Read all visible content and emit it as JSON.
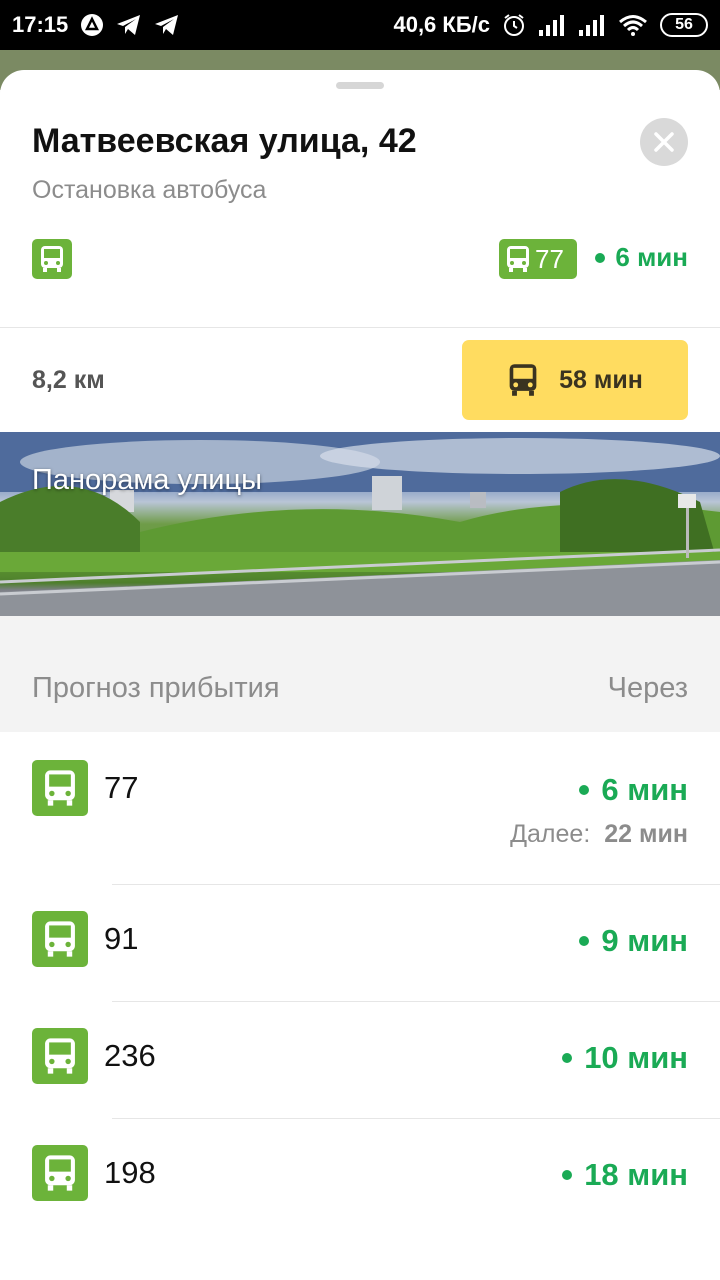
{
  "status_bar": {
    "time": "17:15",
    "speed": "40,6 КБ/с",
    "battery": "56",
    "icons": [
      "app-icon",
      "telegram-icon",
      "telegram-icon",
      "alarm-icon",
      "signal-icon",
      "signal-icon",
      "wifi-icon",
      "battery-icon"
    ]
  },
  "stop": {
    "title": "Матвеевская улица, 42",
    "subtitle": "Остановка автобуса",
    "nearest_route": "77",
    "nearest_eta": "6 мин",
    "distance": "8,2 км",
    "route_time": "58 мин"
  },
  "panorama": {
    "label": "Панорама улицы"
  },
  "forecast": {
    "header_left": "Прогноз прибытия",
    "header_right": "Через",
    "next_label": "Далее:",
    "rows": [
      {
        "route": "77",
        "eta": "6 мин",
        "next": "22 мин"
      },
      {
        "route": "91",
        "eta": "9 мин"
      },
      {
        "route": "236",
        "eta": "10 мин"
      },
      {
        "route": "198",
        "eta": "18 мин"
      }
    ]
  },
  "colors": {
    "bus_green": "#6cb33a",
    "eta_green": "#1aaa55",
    "route_button": "#ffdc60"
  }
}
